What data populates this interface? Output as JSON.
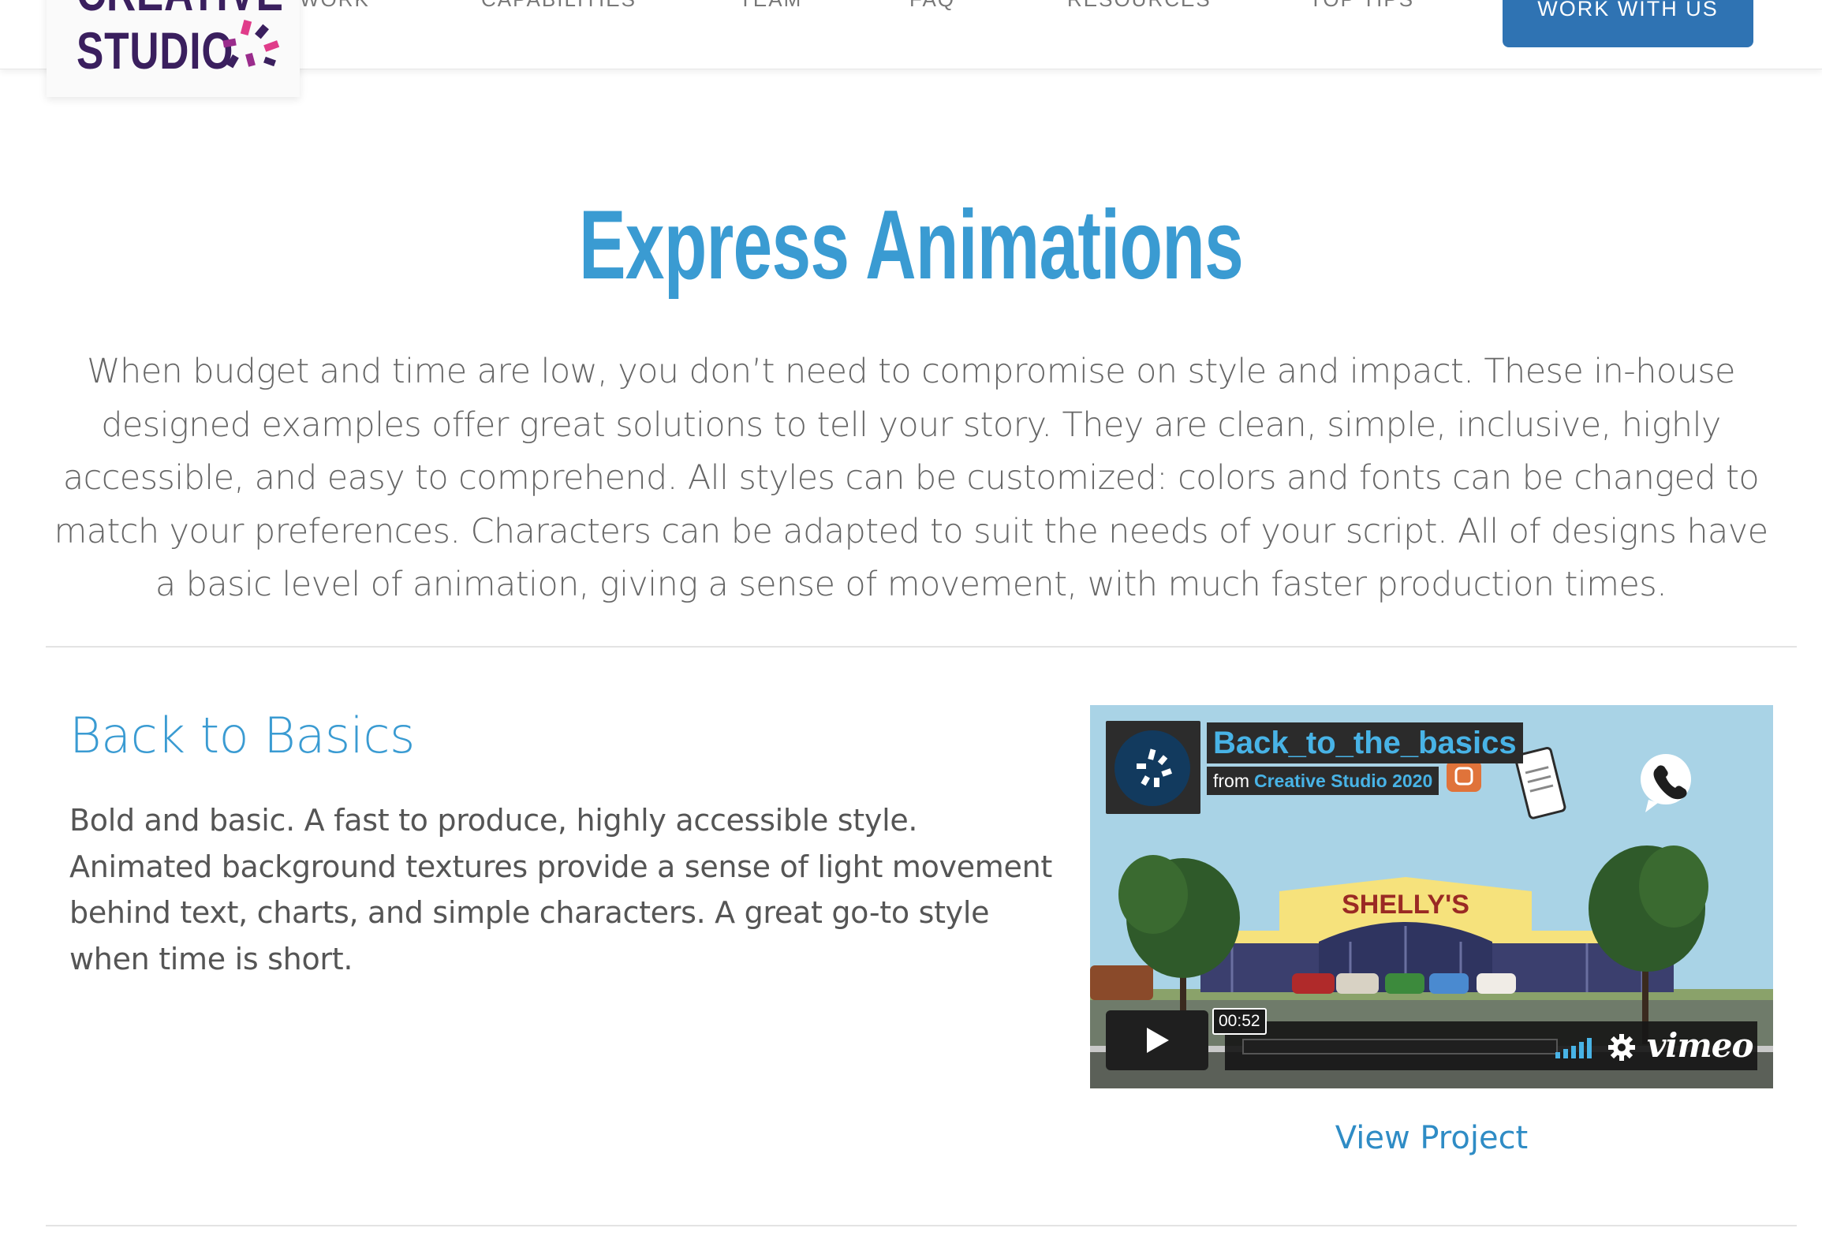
{
  "header": {
    "logo": {
      "line1": "CREATIVE",
      "line2": "STUDIO",
      "mark_colors": [
        "#e03c8a",
        "#3a1f5e",
        "#9a2c8c"
      ]
    },
    "nav": [
      {
        "label": "WORK"
      },
      {
        "label": "CAPABILITIES"
      },
      {
        "label": "TEAM"
      },
      {
        "label": "FAQ"
      },
      {
        "label": "RESOURCES"
      },
      {
        "label": "TOP TIPS"
      }
    ],
    "cta": "WORK WITH US"
  },
  "hero": {
    "title": "Express Animations",
    "intro": "When budget and time are low, you don’t need to compromise on style and impact. These in-house designed examples offer great solutions to tell your story. They are clean, simple, inclusive, highly accessible, and easy to comprehend. All styles can be customized: colors and fonts can be changed to match your preferences. Characters can be adapted to suit the needs of your script. All of designs have a basic level of animation, giving a sense of movement, with much faster production times."
  },
  "project": {
    "title": "Back to Basics",
    "description": "Bold and basic. A fast to produce, highly accessible style. Animated background textures provide a sense of light movement behind text, charts, and simple characters. A great go-to style when time is short.",
    "video": {
      "title": "Back_to_the_basics",
      "byline_from": "from",
      "byline_owner": "Creative Studio 2020",
      "time": "00:52",
      "brand": "vimeo",
      "store_sign": "SHELLY'S",
      "icons": [
        "play-icon",
        "volume-icon",
        "settings-icon",
        "phone-chat-icon",
        "mobile-phone-icon"
      ],
      "accent_color": "#48b3e6"
    },
    "view_link": "View Project"
  },
  "colors": {
    "title_blue": "#3a9bd2",
    "cta_blue": "#2f73b3",
    "body_text": "#555555"
  }
}
